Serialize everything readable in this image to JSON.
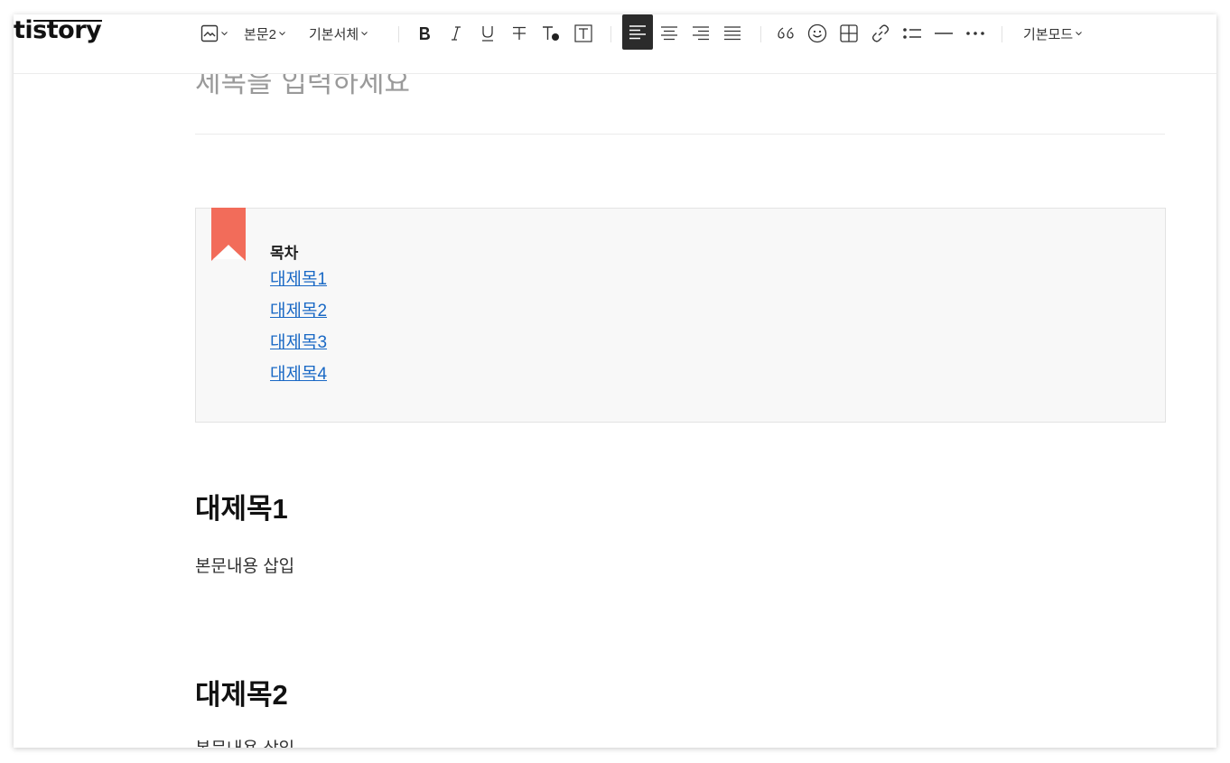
{
  "app": {
    "logo": "tistory"
  },
  "toolbar": {
    "paragraph_style": "본문2",
    "font": "기본서체",
    "mode": "기본모드",
    "icons": [
      "image-icon",
      "bold-icon",
      "italic-icon",
      "underline-icon",
      "strikethrough-icon",
      "text-color-icon",
      "text-background-icon",
      "align-left-icon",
      "align-center-icon",
      "align-right-icon",
      "align-justify-icon",
      "quote-icon",
      "emoticon-icon",
      "table-icon",
      "link-icon",
      "list-icon",
      "divider-icon",
      "more-icon"
    ],
    "active_align": "left",
    "active_color": "#2b2b2b"
  },
  "editor": {
    "title_placeholder": "제목을 입력하세요",
    "toc": {
      "title": "목차",
      "items": [
        "대제목1",
        "대제목2",
        "대제목3",
        "대제목4"
      ],
      "accent": "#f26c5a",
      "link_color": "#1a69c5"
    },
    "sections": [
      {
        "heading": "대제목1",
        "body": "본문내용 삽입"
      },
      {
        "heading": "대제목2",
        "body": "본문내용 삽입"
      }
    ]
  }
}
